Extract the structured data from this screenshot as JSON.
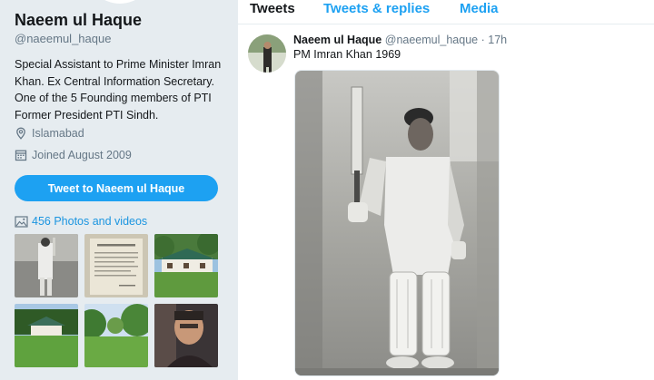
{
  "profile": {
    "name": "Naeem ul Haque",
    "handle": "@naeemul_haque",
    "bio": "Special Assistant to Prime Minister Imran Khan. Ex Central Information Secretary. One of the 5 Founding members of PTI Former President PTI Sindh.",
    "location": "Islamabad",
    "joined": "Joined August 2009",
    "tweet_to_label": "Tweet to Naeem ul Haque",
    "photos_label": "456 Photos and videos"
  },
  "tabs": [
    {
      "label": "Tweets",
      "active": true
    },
    {
      "label": "Tweets & replies",
      "active": false
    },
    {
      "label": "Media",
      "active": false
    }
  ],
  "tweet": {
    "name": "Naeem ul Haque",
    "handle": "@naeemul_haque",
    "separator": "·",
    "time": "17h",
    "text": "PM Imran Khan 1969"
  },
  "icons": {
    "location": "location-pin-icon",
    "calendar": "calendar-icon",
    "photos": "image-icon"
  },
  "colors": {
    "accent": "#1da1f2",
    "link": "#1b95e0",
    "secondary_text": "#657786",
    "sidebar_bg": "#e6ecf0"
  }
}
